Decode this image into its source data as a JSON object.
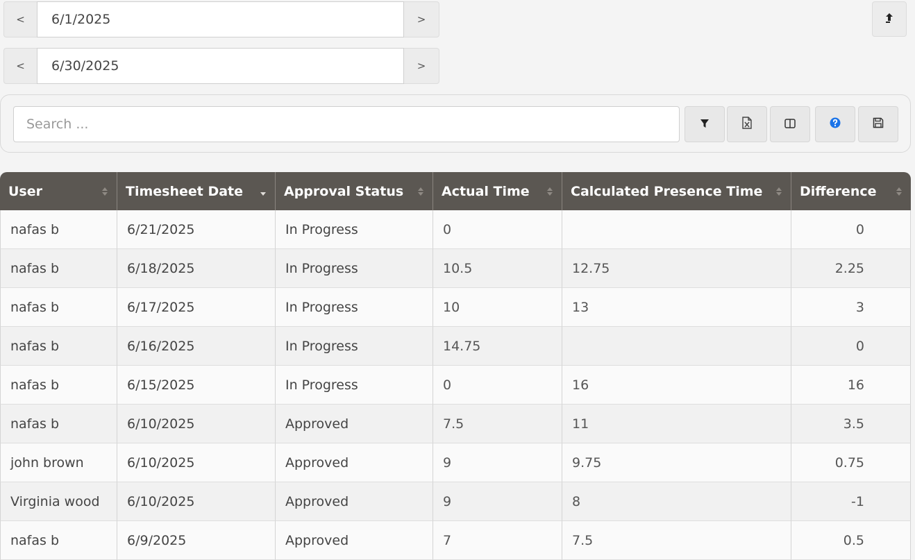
{
  "date_range": {
    "start": {
      "prev_label": "<",
      "value": "6/1/2025",
      "next_label": ">"
    },
    "end": {
      "prev_label": "<",
      "value": "6/30/2025",
      "next_label": ">"
    }
  },
  "corner_button": {
    "icon": "upload-arrow-icon"
  },
  "search": {
    "placeholder": "Search ...",
    "value": ""
  },
  "toolbar": {
    "buttons": [
      {
        "name": "filter-button",
        "icon": "filter-icon"
      },
      {
        "name": "export-excel-button",
        "icon": "excel-file-icon"
      },
      {
        "name": "columns-button",
        "icon": "columns-icon"
      },
      {
        "name": "help-button",
        "icon": "help-circle-icon"
      },
      {
        "name": "save-button",
        "icon": "floppy-disk-icon"
      }
    ]
  },
  "colors": {
    "header_bg": "#5b5752",
    "approved": "#2a8a2a",
    "help_blue": "#1a73e8"
  },
  "table": {
    "columns": [
      {
        "label": "User",
        "sort": "none"
      },
      {
        "label": "Timesheet Date",
        "sort": "descending"
      },
      {
        "label": "Approval Status",
        "sort": "none"
      },
      {
        "label": "Actual Time",
        "sort": "none"
      },
      {
        "label": "Calculated Presence Time",
        "sort": "none"
      },
      {
        "label": "Difference",
        "sort": "none"
      }
    ],
    "rows": [
      {
        "user": "nafas b",
        "date": "6/21/2025",
        "status": "In Progress",
        "actual": "0",
        "presence": "",
        "difference": "0"
      },
      {
        "user": "nafas b",
        "date": "6/18/2025",
        "status": "In Progress",
        "actual": "10.5",
        "presence": "12.75",
        "difference": "2.25"
      },
      {
        "user": "nafas b",
        "date": "6/17/2025",
        "status": "In Progress",
        "actual": "10",
        "presence": "13",
        "difference": "3"
      },
      {
        "user": "nafas b",
        "date": "6/16/2025",
        "status": "In Progress",
        "actual": "14.75",
        "presence": "",
        "difference": "0"
      },
      {
        "user": "nafas b",
        "date": "6/15/2025",
        "status": "In Progress",
        "actual": "0",
        "presence": "16",
        "difference": "16"
      },
      {
        "user": "nafas b",
        "date": "6/10/2025",
        "status": "Approved",
        "actual": "7.5",
        "presence": "11",
        "difference": "3.5"
      },
      {
        "user": "john brown",
        "date": "6/10/2025",
        "status": "Approved",
        "actual": "9",
        "presence": "9.75",
        "difference": "0.75"
      },
      {
        "user": "Virginia wood",
        "date": "6/10/2025",
        "status": "Approved",
        "actual": "9",
        "presence": "8",
        "difference": "-1"
      },
      {
        "user": "nafas b",
        "date": "6/9/2025",
        "status": "Approved",
        "actual": "7",
        "presence": "7.5",
        "difference": "0.5"
      }
    ]
  }
}
